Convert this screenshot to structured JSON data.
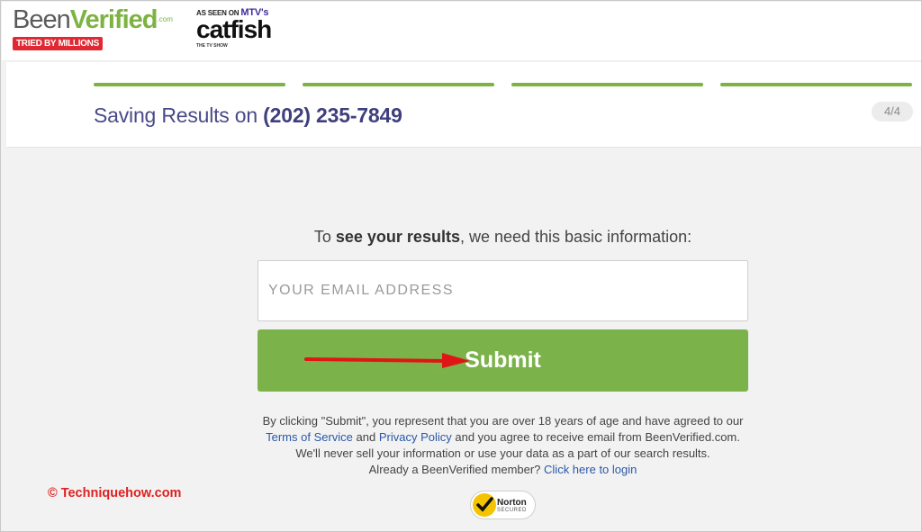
{
  "header": {
    "logo_been": "Been",
    "logo_verified": "Verified",
    "logo_dotcom": ".com",
    "tagline": "TRIED BY MILLIONS",
    "as_seen_on": "AS SEEN ON",
    "mtv": "MTV's",
    "show": "catfish",
    "show_sub": "THE TV SHOW"
  },
  "progress": {
    "steps_total": 4,
    "steps_complete": 4,
    "counter": "4/4"
  },
  "title": {
    "prefix": "Saving Results on ",
    "phone": "(202) 235-7849"
  },
  "form": {
    "prompt_pre": "To ",
    "prompt_bold": "see your results",
    "prompt_post": ", we need this basic information:",
    "email_placeholder": "YOUR EMAIL ADDRESS",
    "email_value": "",
    "submit_label": "Submit"
  },
  "legal": {
    "line1": "By clicking \"Submit\", you represent that you are over 18 years of age and have agreed to our",
    "terms": "Terms of Service",
    "and": " and ",
    "privacy": "Privacy Policy",
    "line2_post": " and you agree to receive email from BeenVerified.com.",
    "line3": "We'll never sell your information or use your data as a part of our search results.",
    "member_text": "Already a BeenVerified member? ",
    "login_link": "Click here to login"
  },
  "badge": {
    "name": "Norton",
    "secured": "SECURED"
  },
  "watermark": "© Techniquehow.com",
  "colors": {
    "brand_green": "#7cb342",
    "title_purple": "#4a4a8a",
    "link_blue": "#2b58a6",
    "badge_red": "#e02a33",
    "annotation_red": "#e02020"
  },
  "icons": {
    "annotation": "red-arrow-icon",
    "norton": "norton-check-icon"
  }
}
